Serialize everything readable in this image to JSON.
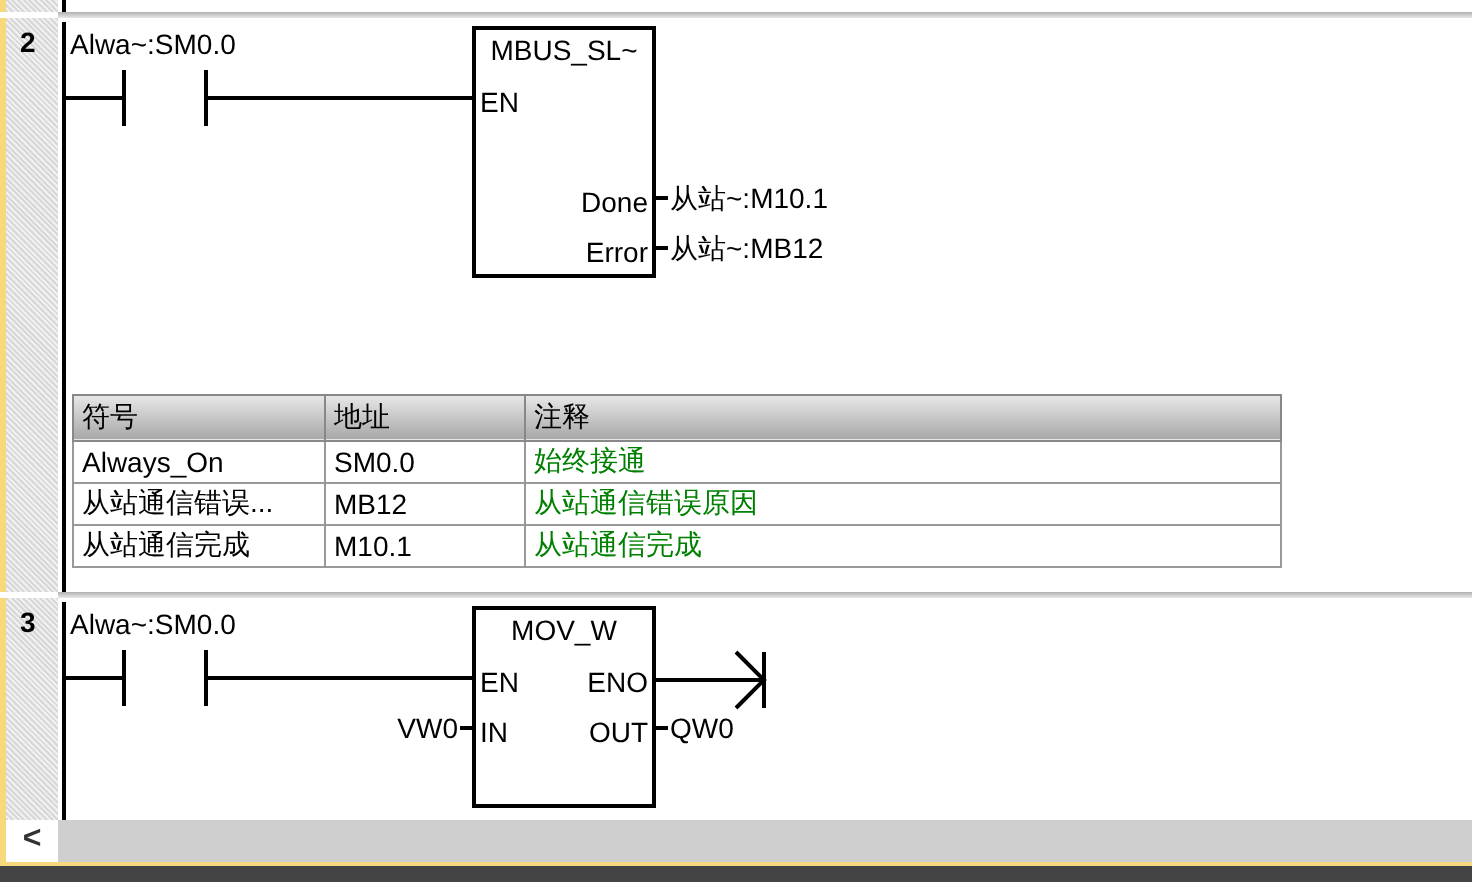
{
  "networks": [
    {
      "number": "2",
      "contact": {
        "label": "Alwa~:SM0.0"
      },
      "box": {
        "title": "MBUS_SL~",
        "inputs": [
          {
            "pin": "EN",
            "kind": "power"
          }
        ],
        "outputs": [
          {
            "pin": "Done",
            "kind": "operand",
            "operand": "从站~:M10.1"
          },
          {
            "pin": "Error",
            "kind": "operand",
            "operand": "从站~:MB12"
          }
        ]
      },
      "symbol_table": {
        "columns": [
          "符号",
          "地址",
          "注释"
        ],
        "rows": [
          {
            "symbol": "Always_On",
            "address": "SM0.0",
            "comment": "始终接通"
          },
          {
            "symbol": "从站通信错误...",
            "address": "MB12",
            "comment": "从站通信错误原因"
          },
          {
            "symbol": "从站通信完成",
            "address": "M10.1",
            "comment": "从站通信完成"
          }
        ]
      }
    },
    {
      "number": "3",
      "contact": {
        "label": "Alwa~:SM0.0"
      },
      "box": {
        "title": "MOV_W",
        "inputs": [
          {
            "pin": "EN",
            "kind": "power"
          },
          {
            "pin": "IN",
            "kind": "operand",
            "operand": "VW0"
          }
        ],
        "outputs": [
          {
            "pin": "ENO",
            "kind": "power"
          },
          {
            "pin": "OUT",
            "kind": "operand",
            "operand": "QW0"
          }
        ]
      }
    }
  ],
  "scrollbar": {
    "left_button": "<"
  }
}
